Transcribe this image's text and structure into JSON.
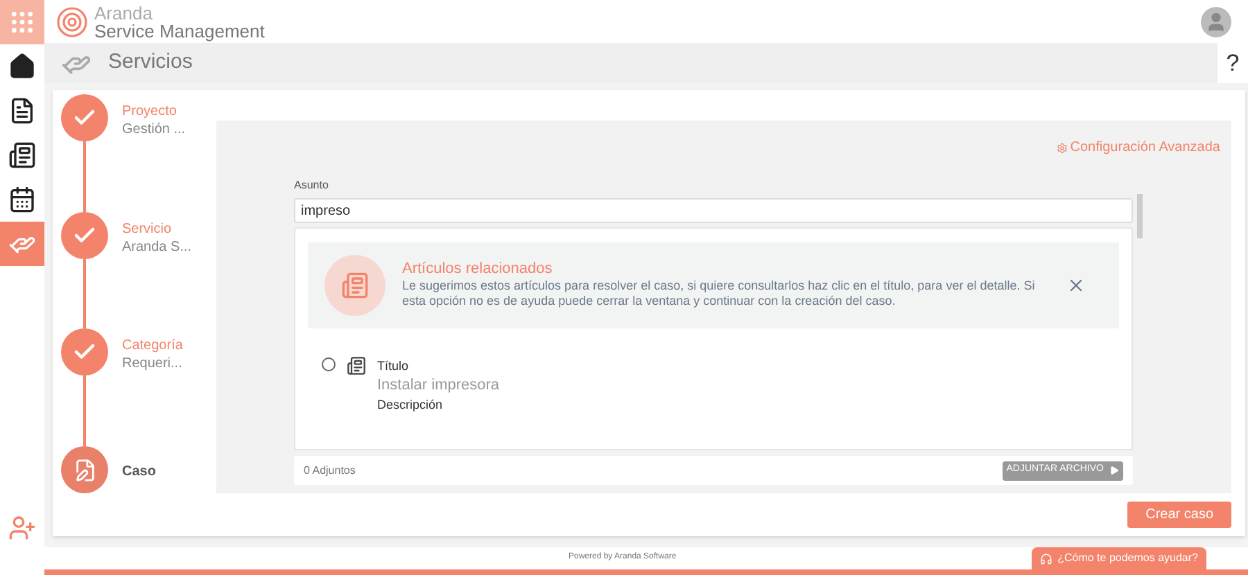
{
  "header": {
    "brand_line1": "Aranda",
    "brand_line2": "Service Management"
  },
  "sidebar": {
    "items": [
      {
        "kind": "apps",
        "selected": false
      },
      {
        "kind": "home",
        "selected": false
      },
      {
        "kind": "document",
        "selected": false
      },
      {
        "kind": "news",
        "selected": false
      },
      {
        "kind": "calendar",
        "selected": false
      },
      {
        "kind": "services",
        "selected": true
      }
    ]
  },
  "title_bar": {
    "title": "Servicios",
    "help": "?"
  },
  "steps": [
    {
      "kind": "done",
      "title": "Proyecto",
      "subtitle": "Gestión ..."
    },
    {
      "kind": "done",
      "title": "Servicio",
      "subtitle": "Aranda S..."
    },
    {
      "kind": "done",
      "title": "Categoría",
      "subtitle": "Requeri..."
    },
    {
      "kind": "current",
      "title": "Caso"
    }
  ],
  "advanced_link": "Configuración Avanzada",
  "subject": {
    "label": "Asunto",
    "value": "impreso"
  },
  "related": {
    "title": "Artículos relacionados",
    "text": "Le sugerimos estos artículos para resolver el caso, si quiere consultarlos haz clic en el título, para ver el detalle. Si esta opción no es de ayuda puede cerrar la ventana y continuar con la creación del caso."
  },
  "articles": [
    {
      "title_label": "Título",
      "title": "Instalar impresora",
      "description_label": "Descripción",
      "selected": false
    }
  ],
  "attachments": {
    "count": "0 Adjuntos",
    "button": "ADJUNTAR ARCHIVO"
  },
  "create_button": "Crear caso",
  "footer": {
    "powered": "Powered by Aranda Software",
    "help_button": "¿Cómo te podemos ayudar?"
  }
}
